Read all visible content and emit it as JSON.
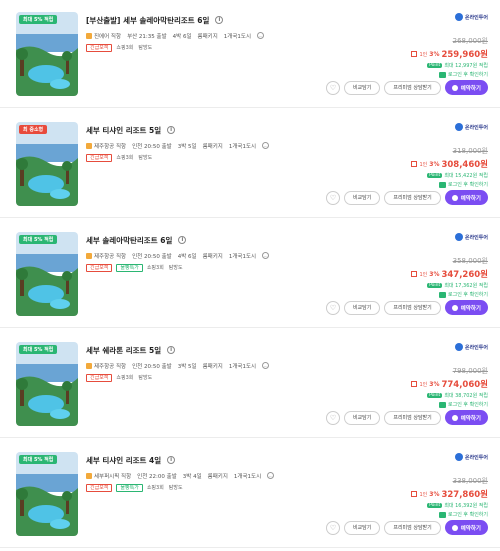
{
  "colors": {
    "accent_red": "#e64c3c",
    "accent_green": "#2bb673",
    "book_purple": "#7b4df2",
    "vendor_blue": "#2b3a8c"
  },
  "cards": [
    {
      "badge": "최대 5% 적립",
      "badge_kind": "green",
      "title": "[부산출발] 세부 솔레아막탄리조트 6일",
      "details": [
        "진에어 직항",
        "부산 21:35 출발",
        "4박 6일",
        "룸패키지",
        "1개국1도시"
      ],
      "tags": [
        "긴급모객"
      ],
      "tag_texts": [
        "쇼핑3회",
        "탐방도"
      ],
      "vendor": "온라인투어",
      "original_price": "268,000원",
      "sale_label": "1인",
      "sale_pct": "3%",
      "sale_price": "259,960원",
      "point_chip": "Point",
      "point_text": "최대 12,997원 적립",
      "login_text": "로그인 후 확인하기",
      "compare_label": "비교담기",
      "premium_label": "프리미엄 상담받기",
      "book_label": "예약하기"
    },
    {
      "badge": "최 중소형",
      "badge_kind": "hot",
      "title": "세부 티샤인 리조트 5일",
      "details": [
        "제주항공 직항",
        "인천 20:50 출발",
        "3박 5일",
        "룸패키지",
        "1개국1도시"
      ],
      "tags": [
        "긴급모객"
      ],
      "tag_texts": [
        "쇼핑3회",
        "탐방도"
      ],
      "vendor": "온라인투어",
      "original_price": "318,000원",
      "sale_label": "1인",
      "sale_pct": "3%",
      "sale_price": "308,460원",
      "point_chip": "Point",
      "point_text": "최대 15,422원 적립",
      "login_text": "로그인 후 확인하기",
      "compare_label": "비교담기",
      "premium_label": "프리미엄 상담받기",
      "book_label": "예약하기"
    },
    {
      "badge": "최대 5% 적립",
      "badge_kind": "green",
      "title": "세부 솔레아막탄리조트 6일",
      "details": [
        "제주항공 직항",
        "인천 20:50 출발",
        "4박 6일",
        "룸패키지",
        "1개국1도시"
      ],
      "tags": [
        "긴급모객",
        "물빵특가"
      ],
      "tag_texts": [
        "쇼핑3회",
        "탐방도"
      ],
      "vendor": "온라인투어",
      "original_price": "358,000원",
      "sale_label": "1인",
      "sale_pct": "3%",
      "sale_price": "347,260원",
      "point_chip": "Point",
      "point_text": "최대 17,362원 적립",
      "login_text": "로그인 후 확인하기",
      "compare_label": "비교담기",
      "premium_label": "프리미엄 상담받기",
      "book_label": "예약하기"
    },
    {
      "badge": "최대 5% 적립",
      "badge_kind": "green",
      "title": "세부 쉐라톤 리조트 5일",
      "details": [
        "제주항공 직항",
        "인천 20:50 출발",
        "3박 5일",
        "룸패키지",
        "1개국1도시"
      ],
      "tags": [
        "긴급모객"
      ],
      "tag_texts": [
        "쇼핑3회",
        "탐방도"
      ],
      "vendor": "온라인투어",
      "original_price": "798,000원",
      "sale_label": "1인",
      "sale_pct": "3%",
      "sale_price": "774,060원",
      "point_chip": "Point",
      "point_text": "최대 38,702원 적립",
      "login_text": "로그인 후 확인하기",
      "compare_label": "비교담기",
      "premium_label": "프리미엄 상담받기",
      "book_label": "예약하기"
    },
    {
      "badge": "최대 5% 적립",
      "badge_kind": "green",
      "title": "세부 티샤인 리조트 4일",
      "details": [
        "세부퍼시픽 직항",
        "인천 22:00 출발",
        "3박 4일",
        "룸패키지",
        "1개국1도시"
      ],
      "tags": [
        "긴급모객",
        "물빵특가"
      ],
      "tag_texts": [
        "쇼핑3회",
        "탐방도"
      ],
      "vendor": "온라인투어",
      "original_price": "338,000원",
      "sale_label": "1인",
      "sale_pct": "3%",
      "sale_price": "327,860원",
      "point_chip": "Point",
      "point_text": "최대 16,392원 적립",
      "login_text": "로그인 후 확인하기",
      "compare_label": "비교담기",
      "premium_label": "프리미엄 상담받기",
      "book_label": "예약하기"
    }
  ]
}
